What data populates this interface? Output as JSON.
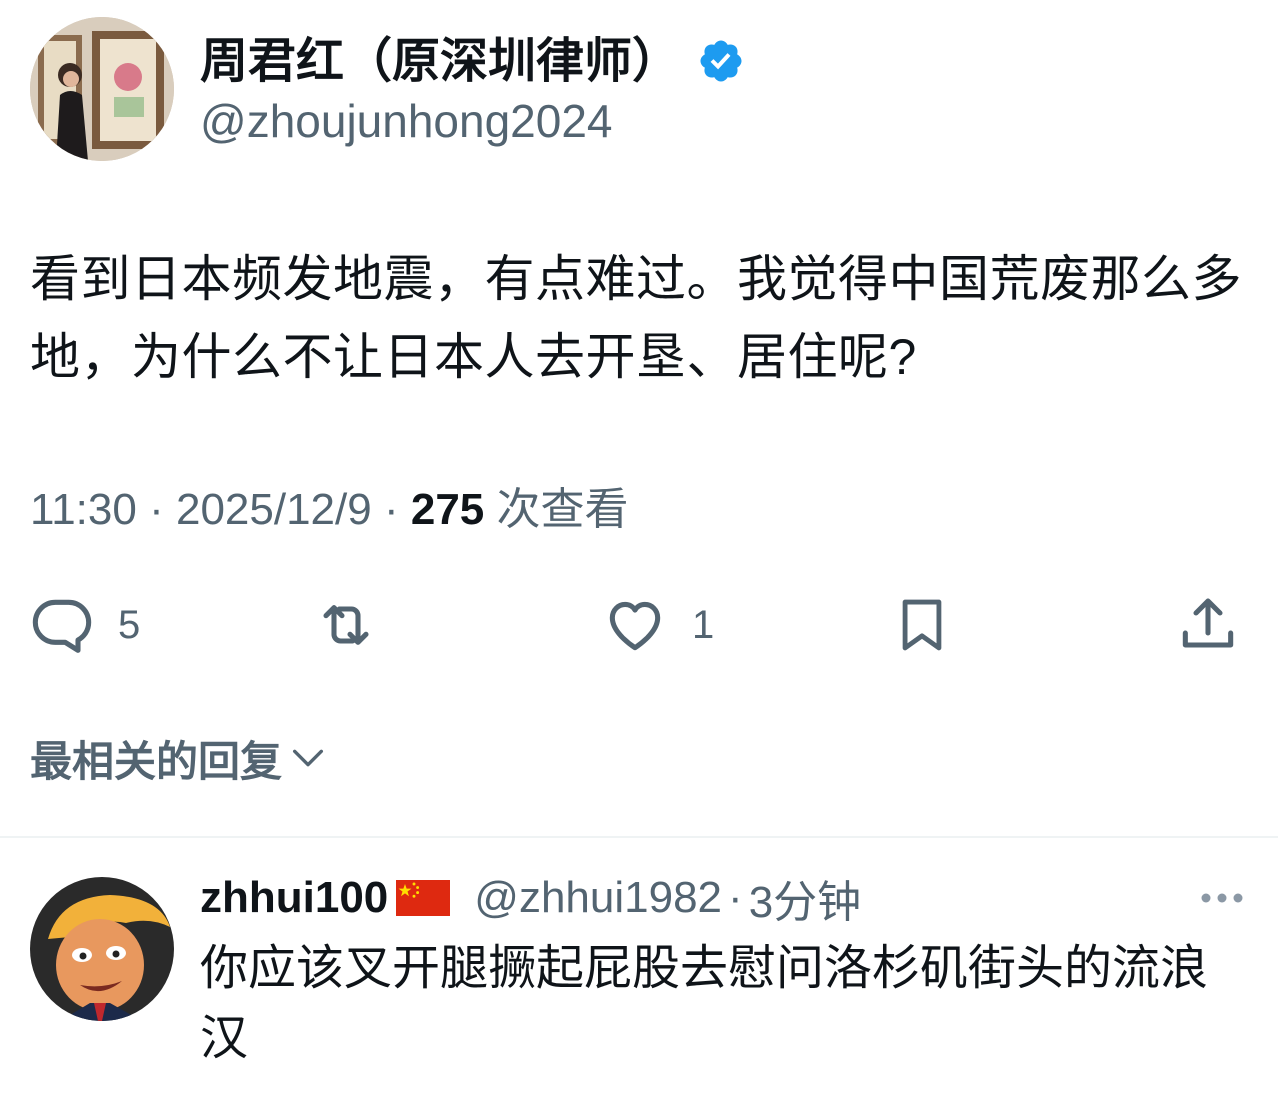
{
  "tweet": {
    "author_name": "周君红（原深圳律师）",
    "author_handle": "@zhoujunhong2024",
    "verified_icon": "verified-badge-icon",
    "text": "看到日本频发地震，有点难过。我觉得中国荒废那么多地，为什么不让日本人去开垦、居住呢?",
    "time": "11:30",
    "date": "2025/12/9",
    "separator": "·",
    "views_count": "275",
    "views_label": "次查看"
  },
  "actions": {
    "reply_count": "5",
    "retweet_count": "",
    "like_count": "1"
  },
  "replies_sort": {
    "label": "最相关的回复"
  },
  "reply": {
    "name": "zhhui100",
    "flag_icon": "china-flag-icon",
    "handle": "@zhhui1982",
    "separator": "·",
    "time": "3分钟",
    "text": "你应该叉开腿撅起屁股去慰问洛杉矶街头的流浪汉"
  },
  "colors": {
    "text_primary": "#0f1419",
    "text_secondary": "#536471",
    "verified_blue": "#1d9bf0",
    "divider": "#eff3f4"
  }
}
